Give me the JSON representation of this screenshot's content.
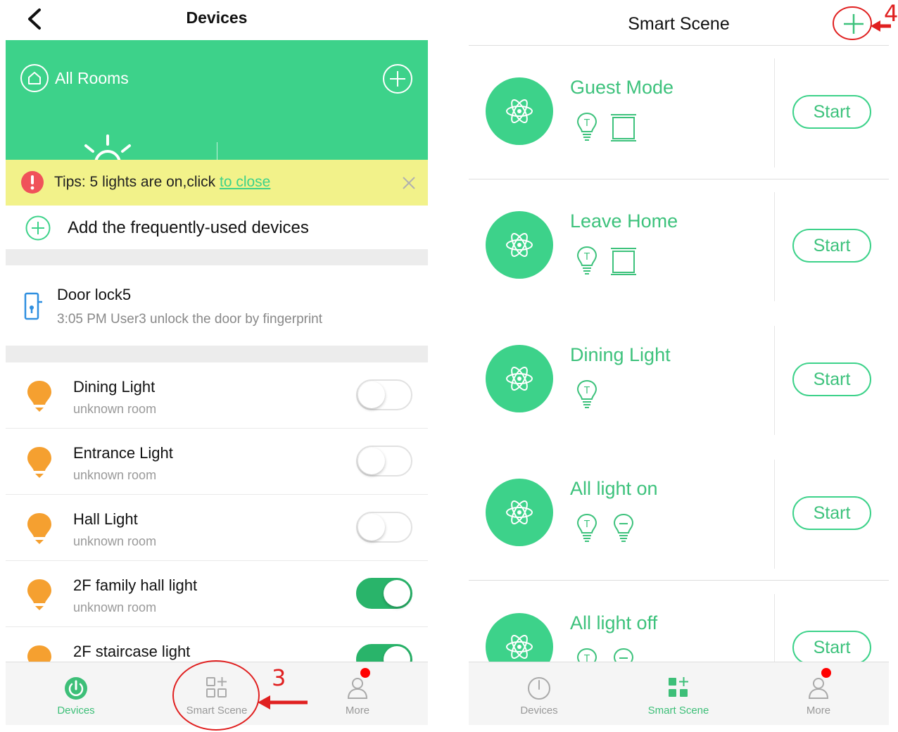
{
  "left": {
    "nav": {
      "title": "Devices"
    },
    "hero": {
      "rooms_label": "All Rooms"
    },
    "tips": {
      "text": "Tips: 5 lights are on,click ",
      "link": "to close"
    },
    "add_frequent": {
      "label": "Add the frequently-used devices"
    },
    "door_lock": {
      "name": "Door lock5",
      "status": "3:05 PM User3  unlock the door by fingerprint"
    },
    "devices": [
      {
        "name": "Dining Light",
        "room": "unknown room",
        "on": false
      },
      {
        "name": "Entrance Light",
        "room": "unknown room",
        "on": false
      },
      {
        "name": "Hall Light",
        "room": "unknown room",
        "on": false
      },
      {
        "name": "2F family hall light",
        "room": "unknown room",
        "on": true
      },
      {
        "name": "2F staircase light",
        "room": "",
        "on": true
      }
    ],
    "tabs": [
      {
        "label": "Devices",
        "active": true
      },
      {
        "label": "Smart Scene",
        "active": false
      },
      {
        "label": "More",
        "active": false
      }
    ]
  },
  "right": {
    "title": "Smart Scene",
    "scenes": [
      {
        "name": "Guest Mode",
        "start_label": "Start",
        "device_icons": [
          "bulb-icon",
          "curtain-icon"
        ]
      },
      {
        "name": "Leave Home",
        "start_label": "Start",
        "device_icons": [
          "bulb-icon",
          "curtain-icon"
        ]
      },
      {
        "name": "Dining Light",
        "start_label": "Start",
        "device_icons": [
          "bulb-icon"
        ]
      },
      {
        "name": "All light on",
        "start_label": "Start",
        "device_icons": [
          "bulb-icon",
          "bulb-minus-icon"
        ]
      },
      {
        "name": "All light off",
        "start_label": "Start",
        "device_icons": [
          "bulb-icon",
          "bulb-minus-icon"
        ]
      }
    ],
    "tabs": [
      {
        "label": "Devices",
        "active": false
      },
      {
        "label": "Smart Scene",
        "active": true
      },
      {
        "label": "More",
        "active": false
      }
    ]
  },
  "annotations": {
    "step3": "3",
    "step4": "4"
  },
  "colors": {
    "brand_green": "#3dd28a",
    "tips_yellow": "#f2f28a",
    "bulb_orange": "#f5a030",
    "annotation_red": "#e02020"
  }
}
